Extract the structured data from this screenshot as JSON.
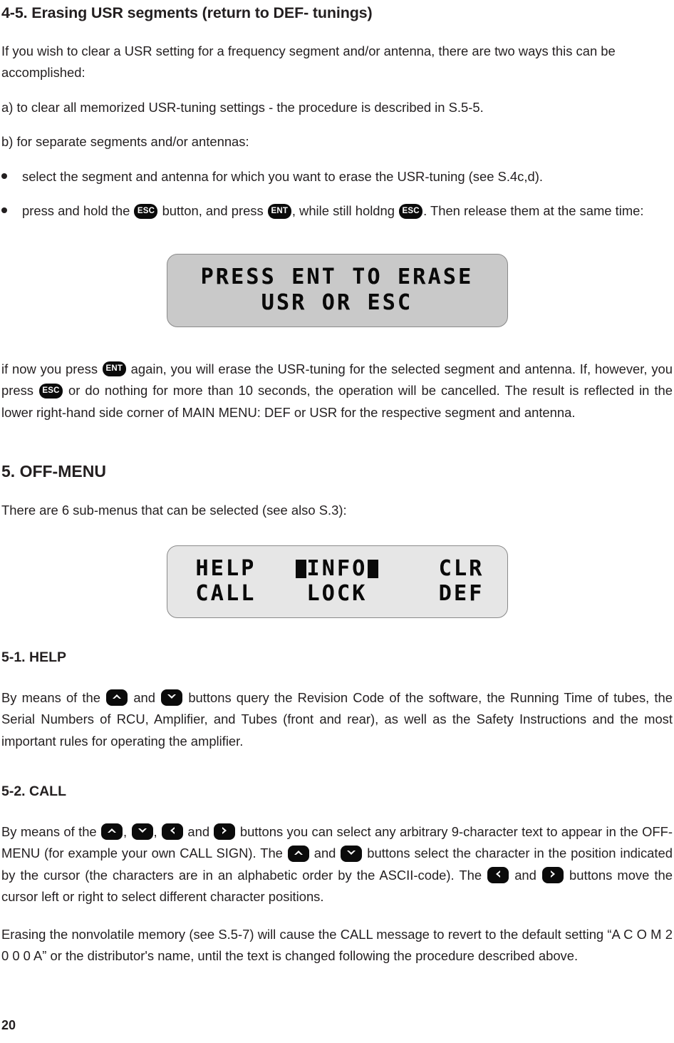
{
  "document": {
    "page_number": "20"
  },
  "sections": {
    "erasing_usr": {
      "heading": "4-5. Erasing USR segments (return to  DEF- tunings)",
      "intro": "If you wish to clear a USR setting for a frequency segment and/or antenna, there are two ways this can be accomplished:",
      "option_a": "a) to clear all memorized USR-tuning settings - the procedure is described in S.5-5.",
      "option_b": "b) for separate segments and/or antennas:",
      "bullet_1": "select the segment and antenna for which you want to erase the USR-tuning (see S.4c,d).",
      "bullet_2_part_1": "press and hold the",
      "bullet_2_part_2": "button, and press",
      "bullet_2_part_3": ", while still holdng",
      "bullet_2_part_4": ". Then release them at the same time:",
      "after_display_part_1": "if now you press",
      "after_display_part_2": "again, you will erase the USR-tuning for the selected segment and antenna. If, however, you press",
      "after_display_part_3": "or do nothing for more than 10 seconds, the operation will be cancelled. The result is reflected in the lower right-hand side corner of MAIN MENU: DEF or USR for the respective segment and antenna."
    },
    "off_menu": {
      "heading": "5. OFF-MENU",
      "intro": "There are 6 sub-menus that can be selected (see also S.3):"
    },
    "help": {
      "heading": "5-1. HELP",
      "text_part_1": "By means of the",
      "text_part_2": "and",
      "text_part_3": "buttons query the Revision Code of the software, the Running Time of tubes, the Serial Numbers of RCU, Amplifier, and Tubes (front and rear), as well as the Safety Instructions and the most important rules for operating the amplifier."
    },
    "call": {
      "heading": "5-2. CALL",
      "text_part_1": "By means of the",
      "text_part_2": ",",
      "text_part_3": ",",
      "text_part_4": "and",
      "text_part_5": "buttons you can select any arbitrary 9-character text to appear in the OFF-MENU (for example your own CALL SIGN). The",
      "text_part_6": "and",
      "text_part_7": "buttons select the character in the position indicated by the cursor (the characters are in an alphabetic order by the ASCII-code). The",
      "text_part_8": "and",
      "text_part_9": "buttons move the cursor left or right to select different character positions.",
      "final_paragraph": "Erasing the nonvolatile memory (see S.5-7) will cause the CALL message to revert to the default setting “A C O M 2 0 0 0 A” or the distributor's name, until the text is changed following the procedure described above."
    }
  },
  "keys": {
    "esc": "ESC",
    "ent": "ENT",
    "up": "up-arrow",
    "down": "down-arrow",
    "left": "left-arrow",
    "right": "right-arrow"
  },
  "displays": {
    "erase_prompt": {
      "line1": "PRESS ENT TO ERASE",
      "line2": "USR OR ESC"
    },
    "off_menu": {
      "row1_col1": "HELP",
      "row1_col2": "INFO",
      "row1_col3": "CLR",
      "row2_col1": "CALL",
      "row2_col2": "LOCK",
      "row2_col3": "DEF"
    }
  },
  "colors": {
    "text": "#231f20",
    "key_background": "#0b0b0b",
    "key_foreground": "#ffffff",
    "lcd_dark_background": "#c9c9c9",
    "lcd_light_background": "#e6e6e6",
    "lcd_border": "#8a8a8a"
  }
}
